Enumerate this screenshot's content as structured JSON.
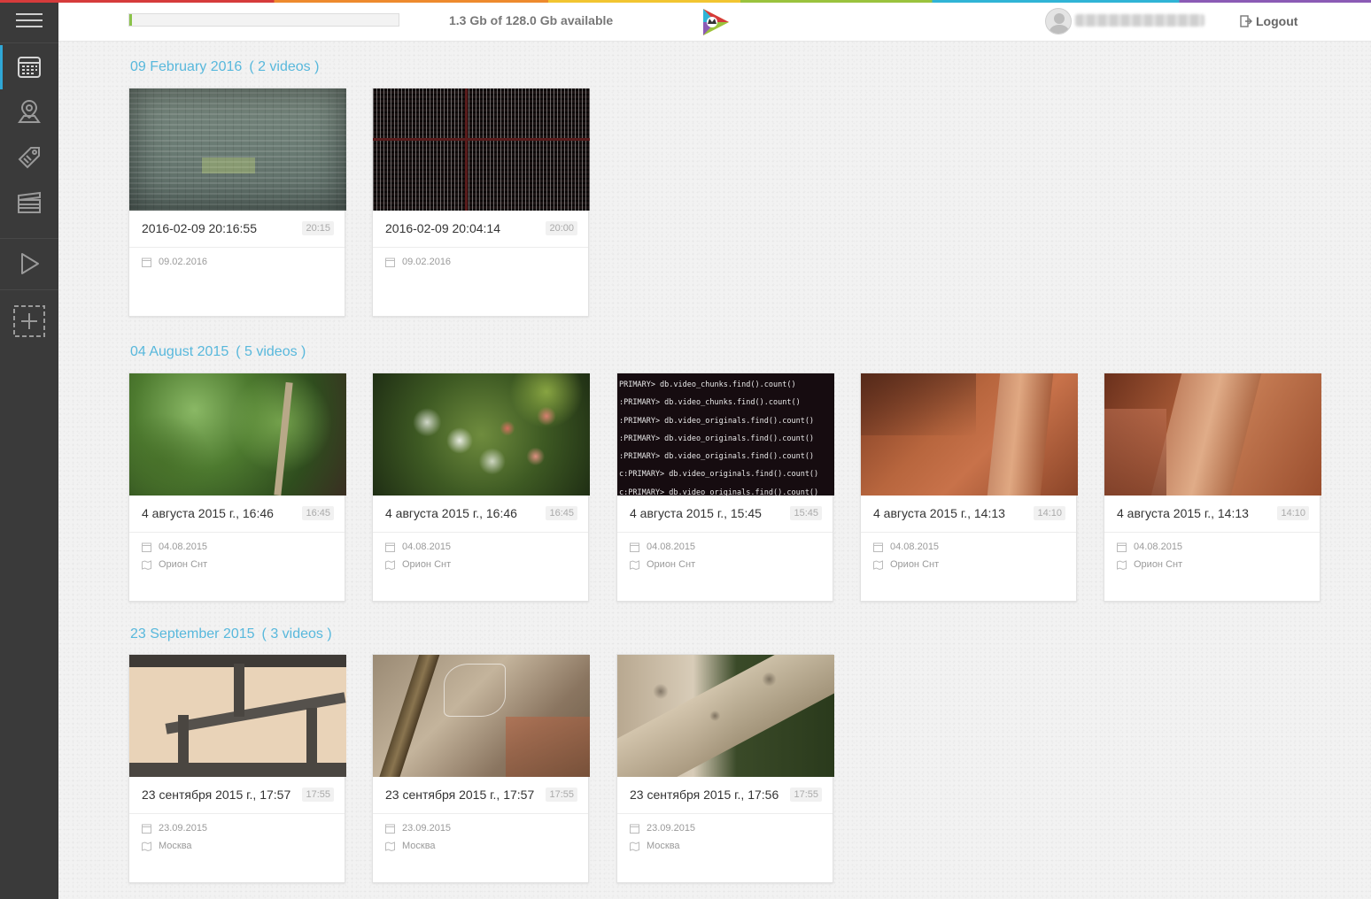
{
  "header": {
    "storage_text": "1.3 Gb of 128.0 Gb available",
    "storage_used_fraction": 0.01,
    "logout_label": "Logout"
  },
  "sidebar": {
    "items": [
      {
        "icon": "calendar-icon",
        "active": true
      },
      {
        "icon": "map-pin-icon",
        "active": false
      },
      {
        "icon": "tag-icon",
        "active": false
      },
      {
        "icon": "clapperboard-icon",
        "active": false
      },
      {
        "icon": "play-icon",
        "active": false
      },
      {
        "icon": "add-icon",
        "active": false
      }
    ]
  },
  "groups": [
    {
      "title": "09 February 2016",
      "count": "( 2 videos )",
      "cards": [
        {
          "title": "2016-02-09 20:16:55",
          "time": "20:15",
          "date": "09.02.2016",
          "place": ""
        },
        {
          "title": "2016-02-09 20:04:14",
          "time": "20:00",
          "date": "09.02.2016",
          "place": ""
        }
      ]
    },
    {
      "title": "04 August 2015",
      "count": "( 5 videos )",
      "cards": [
        {
          "title": "4 августа 2015 г., 16:46",
          "time": "16:45",
          "date": "04.08.2015",
          "place": "Орион Снт"
        },
        {
          "title": "4 августа 2015 г., 16:46",
          "time": "16:45",
          "date": "04.08.2015",
          "place": "Орион Снт"
        },
        {
          "title": "4 августа 2015 г., 15:45",
          "time": "15:45",
          "date": "04.08.2015",
          "place": "Орион Снт"
        },
        {
          "title": "4 августа 2015 г., 14:13",
          "time": "14:10",
          "date": "04.08.2015",
          "place": "Орион Снт"
        },
        {
          "title": "4 августа 2015 г., 14:13",
          "time": "14:10",
          "date": "04.08.2015",
          "place": "Орион Снт"
        }
      ]
    },
    {
      "title": "23 September 2015",
      "count": "( 3 videos )",
      "cards": [
        {
          "title": "23 сентября 2015 г., 17:57",
          "time": "17:55",
          "date": "23.09.2015",
          "place": "Москва"
        },
        {
          "title": "23 сентября 2015 г., 17:57",
          "time": "17:55",
          "date": "23.09.2015",
          "place": "Москва"
        },
        {
          "title": "23 сентября 2015 г., 17:56",
          "time": "17:55",
          "date": "23.09.2015",
          "place": "Москва"
        }
      ]
    }
  ],
  "terminal_lines": [
    "PRIMARY> db.video_chunks.find().count()",
    ":PRIMARY> db.video_chunks.find().count()",
    ":PRIMARY> db.video_originals.find().count()",
    ":PRIMARY> db.video_originals.find().count()",
    ":PRIMARY> db.video_originals.find().count()",
    "c:PRIMARY> db.video_originals.find().count()",
    "c:PRIMARY> db.video_originals.find().count()"
  ]
}
